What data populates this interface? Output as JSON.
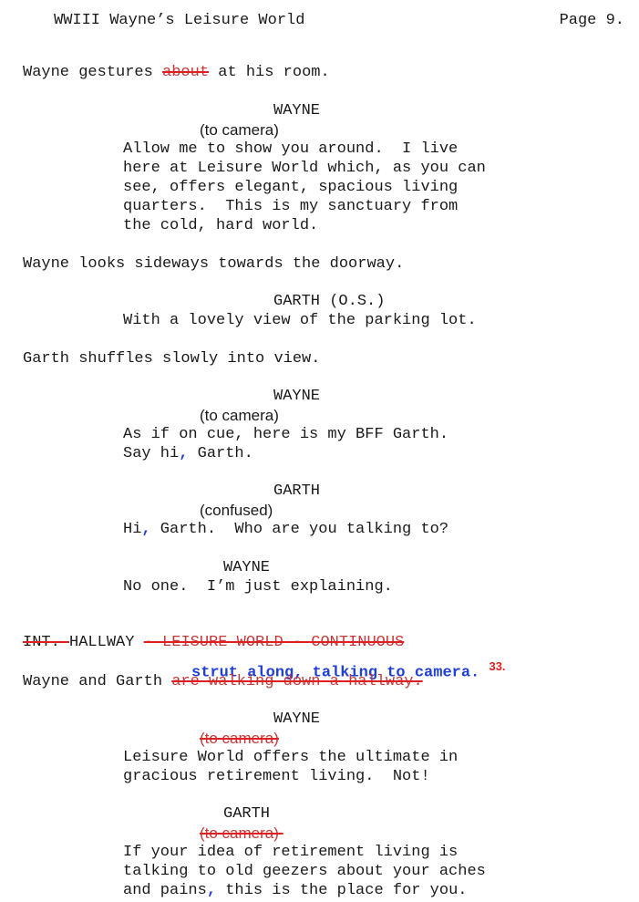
{
  "header": {
    "title": "WWIII Wayne’s Leisure World",
    "page": "Page 9."
  },
  "blocks": {
    "a1_pre": "Wayne gestures ",
    "a1_strike": "about",
    "a1_post": " at his room.",
    "cue_wayne_1": "WAYNE",
    "paren_to_camera_1": "(to camera)",
    "d1_l1": "Allow me to show you around.  I live",
    "d1_l2": "here at Leisure World which, as you can",
    "d1_l3": "see, offers elegant, spacious living",
    "d1_l4": "quarters.  This is my sanctuary from",
    "d1_l5": "the cold, hard world.",
    "a2": "Wayne looks sideways towards the doorway.",
    "cue_garth_os": "GARTH (O.S.)",
    "d2_l1": "With a lovely view of the parking lot.",
    "a3": "Garth shuffles slowly into view.",
    "cue_wayne_2": "WAYNE",
    "paren_to_camera_2": "(to camera)",
    "d3_l1": "As if on cue, here is my BFF Garth.",
    "d3_l2_pre": "Say hi",
    "d3_l2_comma": ",",
    "d3_l2_post": " Garth.",
    "cue_garth_1": "GARTH",
    "paren_confused": "(confused)",
    "d4_pre": "Hi",
    "d4_comma": ",",
    "d4_post": " Garth.  Who are you talking to?",
    "cue_wayne_3": "WAYNE",
    "d5_l1": "No one.  I’m just explaining.",
    "scene_strike1": "INT. ",
    "scene_keep": "HALLWAY ",
    "scene_strike2": "- LEISURE WORLD - CONTINUOUS",
    "insert_text": "strut along, talking to camera.",
    "insert_number": "33.",
    "a4_pre": "Wayne and Garth ",
    "a4_strike": "are walking down a hallway.",
    "cue_wayne_4": "WAYNE",
    "paren_to_camera_3": "(to camera)",
    "d6_l1": "Leisure World offers the ultimate in",
    "d6_l2": "gracious retirement living.  Not!",
    "cue_garth_2": "GARTH",
    "paren_to_camera_4": "(to camera) ",
    "d7_l1": "If your idea of retirement living is",
    "d7_l2": "talking to old geezers about your aches",
    "d7_l3_pre": "and pains",
    "d7_l3_comma": ",",
    "d7_l3_post": " this is the place for you."
  },
  "colors": {
    "strike": "#e02020",
    "insert": "#1f3fd6"
  }
}
